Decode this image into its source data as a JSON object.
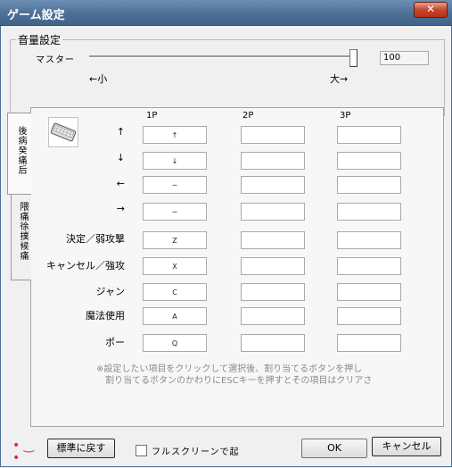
{
  "window": {
    "title": "ゲーム設定",
    "close_label": "✕"
  },
  "volume": {
    "group_title": "音量設定",
    "master_label": "マスター",
    "slider_value": 100,
    "min_label": "←小",
    "max_label": "大→",
    "value_text": "100"
  },
  "tabs": [
    {
      "label": "後病癸痛后"
    },
    {
      "label": "隈痛徐撲候痛"
    }
  ],
  "icons": {
    "gamepad": "gamepad-icon"
  },
  "columns": [
    "1P",
    "2P",
    "3P"
  ],
  "rows": [
    {
      "label": "↑",
      "keys": [
        "↑",
        "",
        ""
      ]
    },
    {
      "label": "↓",
      "keys": [
        "↓",
        "",
        ""
      ]
    },
    {
      "label": "←",
      "keys": [
        "─",
        "",
        ""
      ]
    },
    {
      "label": "→",
      "keys": [
        "─",
        "",
        ""
      ]
    },
    {
      "label": "決定／弱攻撃",
      "keys": [
        "Z",
        "",
        ""
      ]
    },
    {
      "label": "キャンセル／強攻",
      "keys": [
        "X",
        "",
        ""
      ]
    },
    {
      "label": "ジャン",
      "keys": [
        "C",
        "",
        ""
      ]
    },
    {
      "label": "魔法使用",
      "keys": [
        "A",
        "",
        ""
      ]
    },
    {
      "label": "ポー",
      "keys": [
        "Q",
        "",
        ""
      ]
    }
  ],
  "note": {
    "line1": "※設定したい項目をクリックして選択後、割り当てるボタンを押し",
    "line2": "割り当てるボタンのかわりにESCキーを押すとその項目はクリアさ"
  },
  "footer": {
    "reset_button": "標準に戻す",
    "fullscreen_label": "フルスクリーンで起",
    "fullscreen_checked": false,
    "ok_button": "OK",
    "cancel_button": "キャンセル",
    "app_icon_glyph": "• ‿ •"
  },
  "colors": {
    "titlebar": "#4d6f97",
    "close": "#c7452c",
    "app_icon": "#e01b70"
  }
}
